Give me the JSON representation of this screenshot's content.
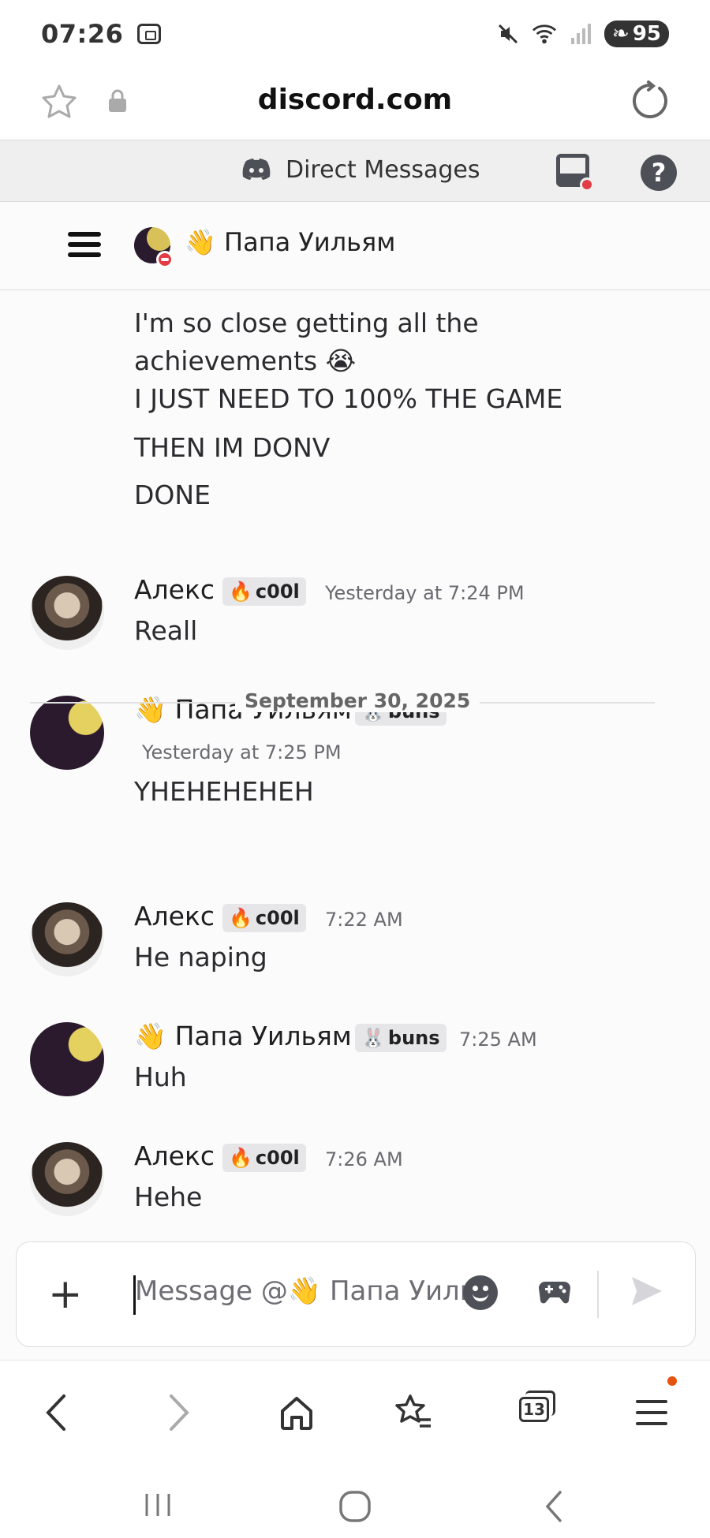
{
  "status_bar": {
    "time": "07:26",
    "battery": "95"
  },
  "browser": {
    "url": "discord.com",
    "tab_count": "13"
  },
  "discord_header": {
    "title": "Direct Messages",
    "help_label": "?"
  },
  "channel": {
    "name": "👋 Папа Уильям"
  },
  "messages": {
    "continued": [
      "I'm so close getting all the",
      "achievements 😭",
      "I JUST NEED TO 100% THE GAME",
      "THEN IM DONV",
      "DONE"
    ],
    "m1": {
      "author": "Алекс",
      "badge": "c00l",
      "badge_emoji": "🔥",
      "time": "Yesterday at 7:24 PM",
      "text": "Reall"
    },
    "m2": {
      "author": "👋 Папа Уильям",
      "badge": "buns",
      "badge_emoji": "🐰",
      "time": "Yesterday at 7:25 PM",
      "text": "YHEHEHEHEH"
    },
    "divider": "September 30, 2025",
    "m3": {
      "author": "Алекс",
      "badge": "c00l",
      "badge_emoji": "🔥",
      "time": "7:22 AM",
      "text": "He naping"
    },
    "m4": {
      "author": "👋 Папа Уильям",
      "badge": "buns",
      "badge_emoji": "🐰",
      "time": "7:25 AM",
      "text": "Huh"
    },
    "m5": {
      "author": "Алекс",
      "badge": "c00l",
      "badge_emoji": "🔥",
      "time": "7:26 AM",
      "text": "Hehe"
    }
  },
  "composer": {
    "placeholder": "Message @👋 Папа Уильям"
  },
  "colors": {
    "dnd": "#e23c45",
    "accent_dot": "#e8520f",
    "badge_bg": "#e6e6e8"
  }
}
